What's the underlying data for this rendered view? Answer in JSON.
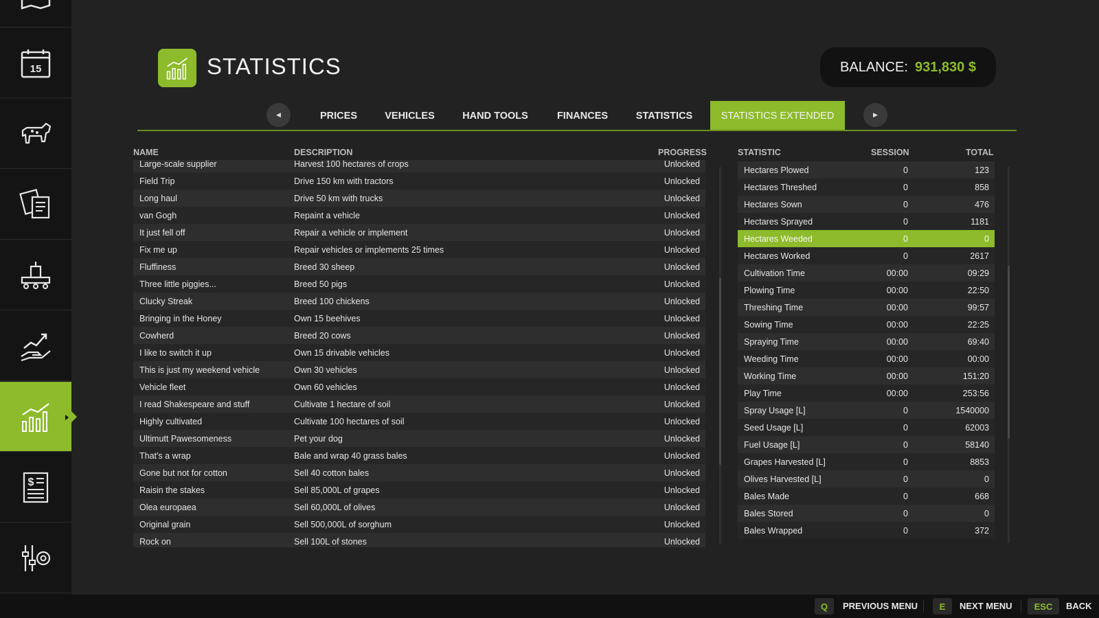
{
  "header": {
    "title": "STATISTICS",
    "balance_label": "BALANCE:",
    "balance_value": "931,830 $"
  },
  "sidebar": {
    "items": [
      {
        "icon": "map-icon"
      },
      {
        "icon": "calendar-icon",
        "text": "15"
      },
      {
        "icon": "animals-icon"
      },
      {
        "icon": "contracts-icon"
      },
      {
        "icon": "production-icon"
      },
      {
        "icon": "prices-hand-icon"
      },
      {
        "icon": "statistics-icon",
        "active": true
      },
      {
        "icon": "finances-icon"
      },
      {
        "icon": "settings-icon"
      }
    ]
  },
  "tabs": [
    {
      "label": "PRICES"
    },
    {
      "label": "VEHICLES"
    },
    {
      "label": "HAND TOOLS"
    },
    {
      "label": "FINANCES"
    },
    {
      "label": "STATISTICS"
    },
    {
      "label": "STATISTICS EXTENDED",
      "active": true
    }
  ],
  "achievements": {
    "headers": {
      "name": "NAME",
      "description": "DESCRIPTION",
      "progress": "PROGRESS"
    },
    "rows": [
      {
        "name": "Large-scale supplier",
        "description": "Harvest 100 hectares of crops",
        "progress": "Unlocked"
      },
      {
        "name": "Field Trip",
        "description": "Drive 150 km with tractors",
        "progress": "Unlocked"
      },
      {
        "name": "Long haul",
        "description": "Drive 50 km with trucks",
        "progress": "Unlocked"
      },
      {
        "name": "van Gogh",
        "description": "Repaint a vehicle",
        "progress": "Unlocked"
      },
      {
        "name": "It just fell off",
        "description": "Repair a vehicle or implement",
        "progress": "Unlocked"
      },
      {
        "name": "Fix me up",
        "description": "Repair vehicles or implements 25 times",
        "progress": "Unlocked"
      },
      {
        "name": "Fluffiness",
        "description": "Breed 30 sheep",
        "progress": "Unlocked"
      },
      {
        "name": "Three little piggies...",
        "description": "Breed 50 pigs",
        "progress": "Unlocked"
      },
      {
        "name": "Clucky Streak",
        "description": "Breed 100 chickens",
        "progress": "Unlocked"
      },
      {
        "name": "Bringing in the Honey",
        "description": "Own 15 beehives",
        "progress": "Unlocked"
      },
      {
        "name": "Cowherd",
        "description": "Breed 20 cows",
        "progress": "Unlocked"
      },
      {
        "name": "I like to switch it up",
        "description": "Own 15 drivable vehicles",
        "progress": "Unlocked"
      },
      {
        "name": "This is just my weekend vehicle",
        "description": "Own 30 vehicles",
        "progress": "Unlocked"
      },
      {
        "name": "Vehicle fleet",
        "description": "Own 60 vehicles",
        "progress": "Unlocked"
      },
      {
        "name": "I read Shakespeare and stuff",
        "description": "Cultivate 1 hectare of soil",
        "progress": "Unlocked"
      },
      {
        "name": "Highly cultivated",
        "description": "Cultivate 100 hectares of soil",
        "progress": "Unlocked"
      },
      {
        "name": "Ultimutt Pawesomeness",
        "description": "Pet your dog",
        "progress": "Unlocked"
      },
      {
        "name": "That's a wrap",
        "description": "Bale and wrap 40 grass bales",
        "progress": "Unlocked"
      },
      {
        "name": "Gone but not for cotton",
        "description": "Sell 40 cotton bales",
        "progress": "Unlocked"
      },
      {
        "name": "Raisin the stakes",
        "description": "Sell 85,000L of grapes",
        "progress": "Unlocked"
      },
      {
        "name": "Olea europaea",
        "description": "Sell 60,000L of olives",
        "progress": "Unlocked"
      },
      {
        "name": "Original grain",
        "description": "Sell 500,000L of sorghum",
        "progress": "Unlocked"
      },
      {
        "name": "Rock on",
        "description": "Sell 100L of stones",
        "progress": "Unlocked"
      }
    ]
  },
  "stats": {
    "headers": {
      "statistic": "STATISTIC",
      "session": "SESSION",
      "total": "TOTAL"
    },
    "rows": [
      {
        "name": "Hectares Plowed",
        "session": "0",
        "total": "123"
      },
      {
        "name": "Hectares Threshed",
        "session": "0",
        "total": "858"
      },
      {
        "name": "Hectares Sown",
        "session": "0",
        "total": "476"
      },
      {
        "name": "Hectares Sprayed",
        "session": "0",
        "total": "1181"
      },
      {
        "name": "Hectares Weeded",
        "session": "0",
        "total": "0",
        "selected": true
      },
      {
        "name": "Hectares Worked",
        "session": "0",
        "total": "2617"
      },
      {
        "name": "Cultivation Time",
        "session": "00:00",
        "total": "09:29"
      },
      {
        "name": "Plowing Time",
        "session": "00:00",
        "total": "22:50"
      },
      {
        "name": "Threshing Time",
        "session": "00:00",
        "total": "99:57"
      },
      {
        "name": "Sowing Time",
        "session": "00:00",
        "total": "22:25"
      },
      {
        "name": "Spraying Time",
        "session": "00:00",
        "total": "69:40"
      },
      {
        "name": "Weeding Time",
        "session": "00:00",
        "total": "00:00"
      },
      {
        "name": "Working Time",
        "session": "00:00",
        "total": "151:20"
      },
      {
        "name": "Play Time",
        "session": "00:00",
        "total": "253:56"
      },
      {
        "name": "Spray Usage [L]",
        "session": "0",
        "total": "1540000"
      },
      {
        "name": "Seed Usage [L]",
        "session": "0",
        "total": "62003"
      },
      {
        "name": "Fuel Usage [L]",
        "session": "0",
        "total": "58140"
      },
      {
        "name": "Grapes Harvested [L]",
        "session": "0",
        "total": "8853"
      },
      {
        "name": "Olives Harvested [L]",
        "session": "0",
        "total": "0"
      },
      {
        "name": "Bales Made",
        "session": "0",
        "total": "668"
      },
      {
        "name": "Bales Stored",
        "session": "0",
        "total": "0"
      },
      {
        "name": "Bales Wrapped",
        "session": "0",
        "total": "372"
      }
    ]
  },
  "footer": {
    "prev_key": "Q",
    "prev_label": "PREVIOUS MENU",
    "next_key": "E",
    "next_label": "NEXT MENU",
    "back_key": "ESC",
    "back_label": "BACK"
  },
  "colors": {
    "accent": "#8dbb2b",
    "background": "#222222",
    "sidebar": "#141414"
  }
}
